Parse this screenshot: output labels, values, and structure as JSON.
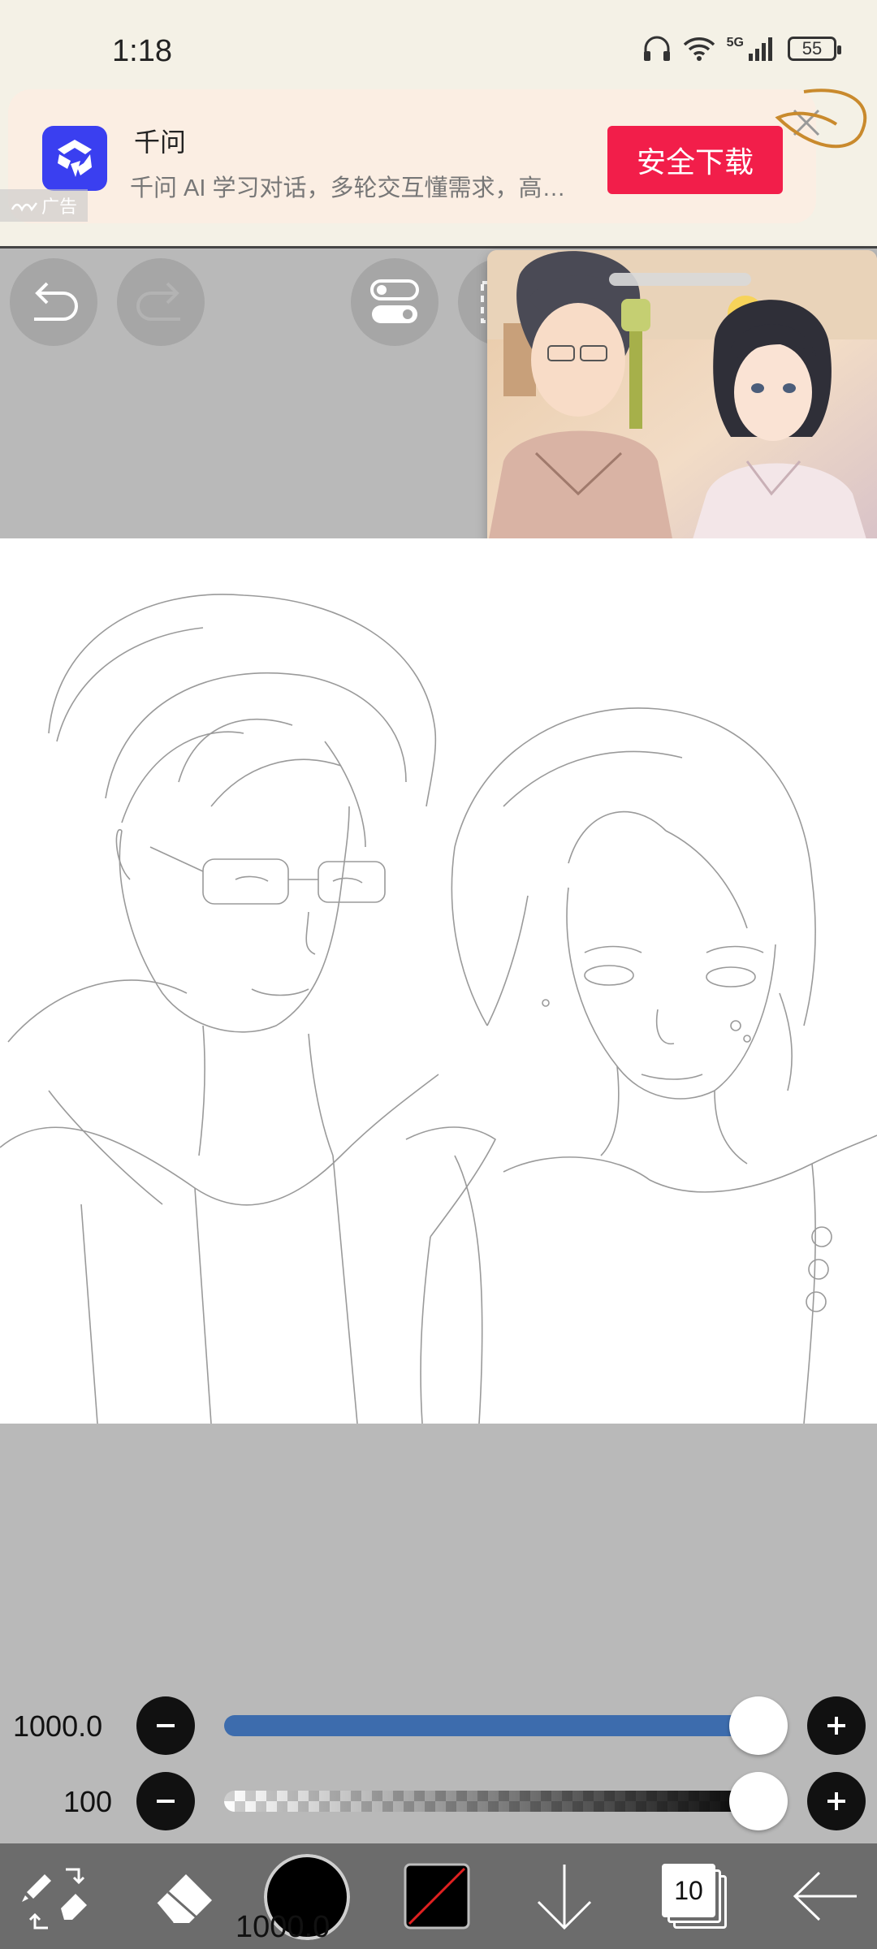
{
  "status_bar": {
    "time": "1:18",
    "network": "5G",
    "battery": "55"
  },
  "ad": {
    "app_name": "千问",
    "description": "千问 AI 学习对话，多轮交互懂需求，高效解决问题",
    "download_label": "安全下载",
    "tag": "广告",
    "accent": "#f21e4a"
  },
  "top_tools": {
    "undo_icon": "undo-icon",
    "redo_icon": "redo-icon",
    "toggle_icon": "toggle-icon"
  },
  "sliders": {
    "size_value": "1000.0",
    "size_fraction": 1.0,
    "opacity_value": "100",
    "opacity_fraction": 1.0
  },
  "bottom_toolbar": {
    "brush_size_label": "1000.0",
    "layer_count": "10",
    "color": "#000000"
  }
}
